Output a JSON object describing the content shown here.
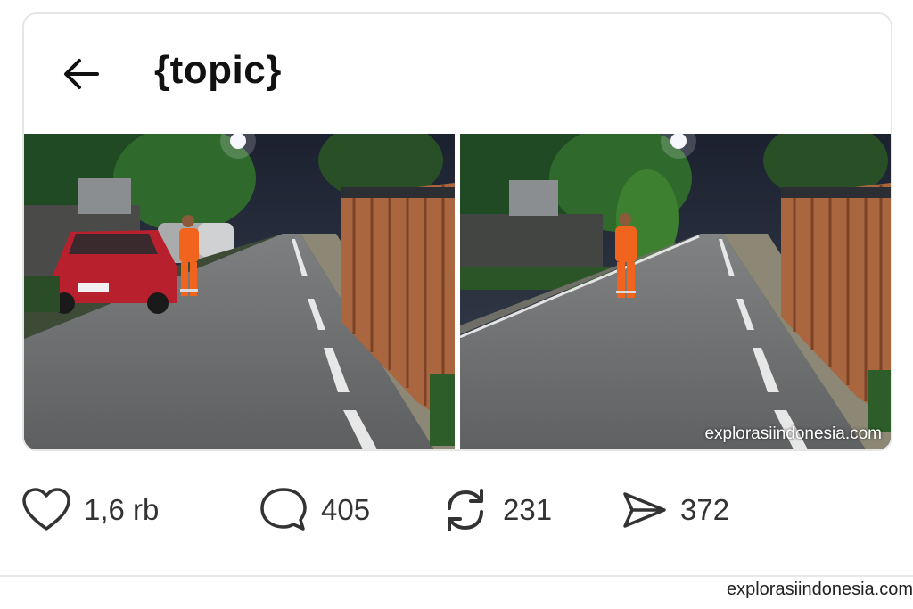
{
  "header": {
    "title": "{topic}",
    "back_icon": "arrow-left-icon"
  },
  "media": {
    "watermark": "explorasiindonesia.com",
    "images": [
      {
        "description_icon": "street-photo-with-red-car"
      },
      {
        "description_icon": "street-photo-empty"
      }
    ]
  },
  "actions": {
    "likes": "1,6 rb",
    "comments": "405",
    "reposts": "231",
    "shares": "372",
    "icons": [
      "heart-icon",
      "comment-icon",
      "repost-icon",
      "share-icon"
    ]
  },
  "footer": {
    "watermark": "explorasiindonesia.com"
  },
  "colors": {
    "text": "#111111",
    "icon": "#333333",
    "vest_orange": "#f0641e",
    "car_red": "#b8202e",
    "fence": "#b0704e"
  }
}
